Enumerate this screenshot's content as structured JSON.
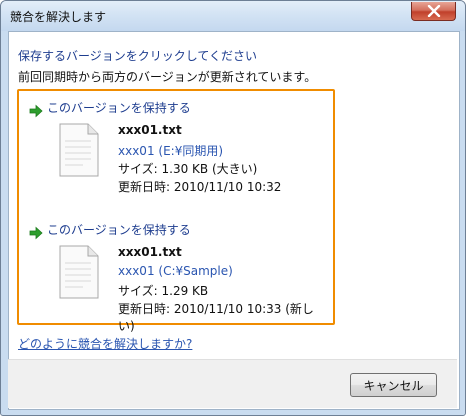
{
  "window": {
    "title": "競合を解決します",
    "close_icon": "close-icon"
  },
  "header": {
    "instruction": "保存するバージョンをクリックしてください",
    "description": "前回同期時から両方のバージョンが更新されています。"
  },
  "versions": [
    {
      "keep_label": "このバージョンを保持する",
      "file_name": "xxx01.txt",
      "location": "xxx01 (E:¥同期用)",
      "size": "サイズ: 1.30 KB (大きい)",
      "modified": "更新日時: 2010/11/10 10:32"
    },
    {
      "keep_label": "このバージョンを保持する",
      "file_name": "xxx01.txt",
      "location": "xxx01 (C:¥Sample)",
      "size": "サイズ: 1.29 KB",
      "modified": "更新日時: 2010/11/10 10:33 (新しい)"
    }
  ],
  "help_link": "どのように競合を解決しますか?",
  "footer": {
    "cancel_label": "キャンセル"
  },
  "colors": {
    "highlight_border": "#f08c00",
    "link": "#1e3d8f",
    "arrow": "#2e9e2e"
  }
}
